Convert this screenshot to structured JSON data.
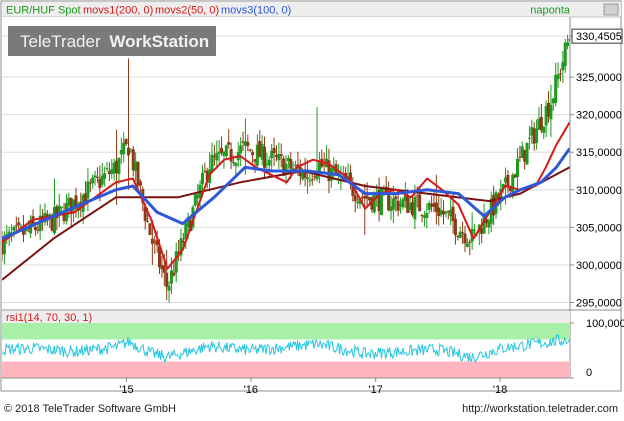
{
  "chart_data": {
    "type": "candlestick",
    "header": {
      "instrument": "EUR/HUF Spot",
      "indicators": [
        "movs1(200, 0)",
        "movs2(50, 0)",
        "movs3(100, 0)"
      ],
      "period": "naponta"
    },
    "watermark": "TeleTrader WorkStation",
    "watermark_parts": [
      "TeleTrader",
      "WorkStation"
    ],
    "price_axis": {
      "ticks": [
        "330,4505",
        "325,0000",
        "320,0000",
        "315,0000",
        "310,0000",
        "305,0000",
        "300,0000",
        "295,0000"
      ],
      "tick_values": [
        330.4505,
        325,
        320,
        315,
        310,
        305,
        300,
        295
      ],
      "range": [
        294,
        333
      ],
      "last_value": "330,4505"
    },
    "x_axis": {
      "labels": [
        "'15",
        "'16",
        "'17",
        "'18"
      ],
      "label_dates": [
        "2015-01-01",
        "2016-01-01",
        "2017-01-01",
        "2018-01-01"
      ],
      "range": [
        "2014-01-01",
        "2018-07-25"
      ]
    },
    "candles": {
      "resample": "weekly",
      "ohlc_samples": [
        [
          "2014-01-01",
          302.0,
          304.5,
          300.5,
          303.0
        ],
        [
          "2014-06-01",
          308.0,
          311.5,
          305.0,
          306.0
        ],
        [
          "2014-12-01",
          311.5,
          318.0,
          308.0,
          313.0
        ],
        [
          "2015-01-08",
          315.0,
          327.5,
          310.0,
          316.0
        ],
        [
          "2015-03-15",
          303.0,
          306.0,
          300.0,
          303.5
        ],
        [
          "2015-05-01",
          300.5,
          302.0,
          295.5,
          297.0
        ],
        [
          "2015-09-01",
          312.0,
          315.0,
          310.0,
          313.5
        ],
        [
          "2015-12-15",
          315.0,
          319.5,
          312.0,
          315.5
        ],
        [
          "2016-06-15",
          312.5,
          314.0,
          309.5,
          312.0
        ],
        [
          "2016-07-15",
          315.0,
          321.0,
          312.0,
          313.5
        ],
        [
          "2016-12-01",
          307.0,
          310.0,
          304.0,
          309.0
        ],
        [
          "2017-07-01",
          309.5,
          312.0,
          306.0,
          307.5
        ],
        [
          "2017-10-10",
          305.0,
          307.0,
          302.0,
          303.5
        ],
        [
          "2018-01-15",
          310.5,
          312.0,
          308.0,
          310.0
        ],
        [
          "2018-06-01",
          319.0,
          324.0,
          317.0,
          322.0
        ],
        [
          "2018-07-24",
          327.0,
          330.5,
          326.0,
          330.4505
        ]
      ]
    },
    "series": [
      {
        "name": "movs1(200, 0)",
        "color": "#7a1212",
        "points": [
          [
            "2014-01-01",
            298.0
          ],
          [
            "2014-06-01",
            303.5
          ],
          [
            "2014-12-01",
            309.0
          ],
          [
            "2015-06-01",
            309.0
          ],
          [
            "2015-12-01",
            311.0
          ],
          [
            "2016-06-01",
            312.5
          ],
          [
            "2016-12-01",
            310.5
          ],
          [
            "2017-06-01",
            309.5
          ],
          [
            "2017-12-01",
            308.5
          ],
          [
            "2018-03-01",
            309.5
          ],
          [
            "2018-07-24",
            313.0
          ]
        ]
      },
      {
        "name": "movs2(50, 0)",
        "color": "#d61a1a",
        "points": [
          [
            "2014-01-01",
            303.0
          ],
          [
            "2014-04-01",
            306.0
          ],
          [
            "2014-08-01",
            307.0
          ],
          [
            "2014-12-01",
            311.0
          ],
          [
            "2015-01-20",
            311.5
          ],
          [
            "2015-03-15",
            306.0
          ],
          [
            "2015-05-01",
            299.5
          ],
          [
            "2015-06-15",
            302.0
          ],
          [
            "2015-09-01",
            312.0
          ],
          [
            "2015-10-15",
            314.0
          ],
          [
            "2015-12-01",
            314.5
          ],
          [
            "2016-01-15",
            313.0
          ],
          [
            "2016-03-01",
            312.0
          ],
          [
            "2016-04-15",
            311.0
          ],
          [
            "2016-05-15",
            313.0
          ],
          [
            "2016-07-01",
            314.0
          ],
          [
            "2016-08-15",
            313.5
          ],
          [
            "2016-10-15",
            311.5
          ],
          [
            "2016-12-01",
            307.5
          ],
          [
            "2017-01-15",
            309.5
          ],
          [
            "2017-03-01",
            310.0
          ],
          [
            "2017-04-15",
            309.0
          ],
          [
            "2017-06-01",
            311.5
          ],
          [
            "2017-07-15",
            310.0
          ],
          [
            "2017-09-01",
            308.0
          ],
          [
            "2017-10-15",
            303.5
          ],
          [
            "2017-12-01",
            307.0
          ],
          [
            "2018-01-15",
            310.5
          ],
          [
            "2018-03-01",
            310.0
          ],
          [
            "2018-04-15",
            310.5
          ],
          [
            "2018-05-15",
            313.0
          ],
          [
            "2018-06-15",
            316.0
          ],
          [
            "2018-07-24",
            319.0
          ]
        ]
      },
      {
        "name": "movs3(100, 0)",
        "color": "#2e58d8",
        "points": [
          [
            "2014-01-01",
            303.5
          ],
          [
            "2014-06-01",
            306.5
          ],
          [
            "2014-12-01",
            310.0
          ],
          [
            "2015-01-20",
            310.5
          ],
          [
            "2015-04-01",
            307.0
          ],
          [
            "2015-06-15",
            305.5
          ],
          [
            "2015-09-15",
            309.0
          ],
          [
            "2015-12-15",
            313.0
          ],
          [
            "2016-03-01",
            312.5
          ],
          [
            "2016-06-15",
            312.5
          ],
          [
            "2016-09-15",
            312.0
          ],
          [
            "2016-12-01",
            309.5
          ],
          [
            "2017-03-01",
            309.5
          ],
          [
            "2017-06-01",
            310.0
          ],
          [
            "2017-09-01",
            309.5
          ],
          [
            "2017-11-15",
            306.5
          ],
          [
            "2018-01-15",
            309.0
          ],
          [
            "2018-03-01",
            310.0
          ],
          [
            "2018-05-01",
            311.0
          ],
          [
            "2018-06-15",
            313.0
          ],
          [
            "2018-07-24",
            315.5
          ]
        ]
      }
    ],
    "rsi": {
      "label": "rsi1(14, 70, 30, 1)",
      "ticks": [
        "100,0000",
        "0"
      ],
      "tick_values": [
        100,
        0
      ],
      "range": [
        0,
        100
      ],
      "overbought": 70,
      "oversold": 30,
      "overbought_color": "#a8f0a8",
      "oversold_color": "#ffb6be",
      "line_color": "#26c6e0",
      "samples": [
        [
          "2014-01-01",
          52
        ],
        [
          "2014-04-01",
          54
        ],
        [
          "2014-08-01",
          48
        ],
        [
          "2014-12-01",
          56
        ],
        [
          "2015-01-10",
          66
        ],
        [
          "2015-03-15",
          45
        ],
        [
          "2015-05-01",
          38
        ],
        [
          "2015-09-01",
          58
        ],
        [
          "2016-01-01",
          50
        ],
        [
          "2016-07-15",
          62
        ],
        [
          "2016-12-01",
          44
        ],
        [
          "2017-07-01",
          52
        ],
        [
          "2017-10-10",
          38
        ],
        [
          "2018-01-15",
          55
        ],
        [
          "2018-06-01",
          66
        ],
        [
          "2018-07-24",
          70
        ]
      ]
    },
    "colors": {
      "candle_up": "#1e9a1e",
      "candle_down": "#8b3a14",
      "axis_label": "#000000",
      "header_bg": "#eeeeee",
      "watermark_bg": "#7a7a7a",
      "frame": "#8c8c8c",
      "grid": "#dddddd"
    }
  },
  "footer": {
    "copyright": "© 2018 TeleTrader Software GmbH",
    "url": "http://workstation.teletrader.com"
  }
}
